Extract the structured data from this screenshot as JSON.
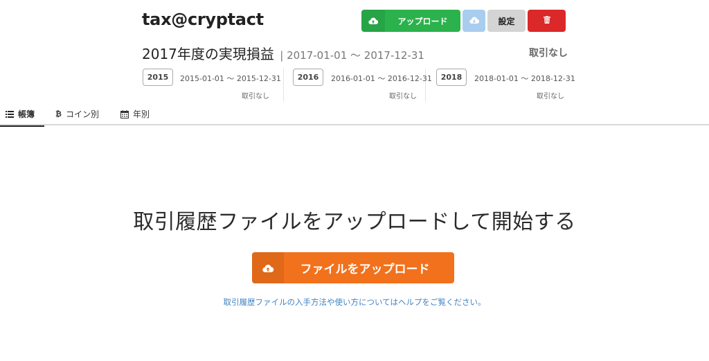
{
  "header": {
    "brand": "tax@cryptact"
  },
  "toolbar": {
    "upload_label": "アップロード",
    "settings_label": "設定"
  },
  "title": {
    "main": "2017年度の実現損益",
    "range": "| 2017-01-01 〜 2017-12-31",
    "status": "取引なし"
  },
  "years": [
    {
      "year": "2015",
      "range": "2015-01-01 〜 2015-12-31",
      "status": "取引なし"
    },
    {
      "year": "2016",
      "range": "2016-01-01 〜 2016-12-31",
      "status": "取引なし"
    },
    {
      "year": "2018",
      "range": "2018-01-01 〜 2018-12-31",
      "status": "取引なし"
    }
  ],
  "tabs": [
    {
      "label": "帳簿",
      "icon": "list-icon",
      "active": true
    },
    {
      "label": "コイン別",
      "icon": "bitcoin-icon",
      "active": false
    },
    {
      "label": "年別",
      "icon": "calendar-icon",
      "active": false
    }
  ],
  "main": {
    "heading": "取引履歴ファイルをアップロードして開始する",
    "upload_button": "ファイルをアップロード",
    "help_text": "取引履歴ファイルの入手方法や使い方についてはヘルプをご覧ください。"
  },
  "colors": {
    "upload_green": "#2bb24c",
    "cloud_blue": "#a9cdee",
    "settings_gray": "#d4d4d4",
    "delete_red": "#db2828",
    "cta_orange": "#f2711c",
    "link_blue": "#4183c4"
  }
}
